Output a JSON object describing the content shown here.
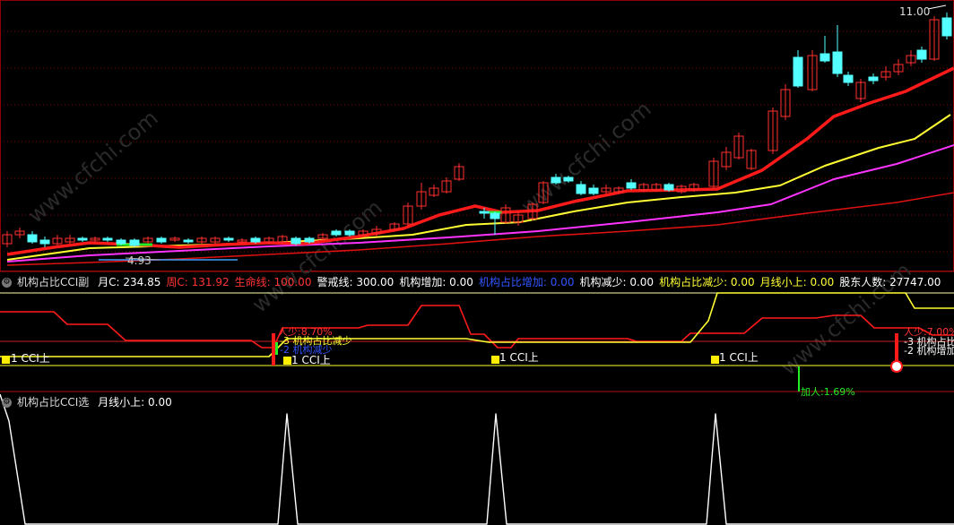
{
  "colors": {
    "background": "#000000",
    "grid": "#8b0000",
    "up_candle": "#ff3030",
    "down_candle": "#54ffff",
    "ma_red": "#ff1a1a",
    "ma_yellow": "#ffff33",
    "ma_magenta": "#ff33ff",
    "ma_dark": "#dd1111",
    "white": "#ffffff",
    "green": "#22ee22",
    "blue": "#3355ff"
  },
  "main_panel": {
    "high_label": "11.00",
    "low_label": "4.93",
    "watermark": "www.cfchi.com"
  },
  "indicator1": {
    "title": "机构占比CCI副",
    "items": [
      {
        "label": "月C: 234.85",
        "color": "#ffffff"
      },
      {
        "label": "周C: 131.92",
        "color": "#ff3333"
      },
      {
        "label": "生命线: 100.00",
        "color": "#ff3333"
      },
      {
        "label": "警戒线: 300.00",
        "color": "#ffffff"
      },
      {
        "label": "机构增加: 0.00",
        "color": "#ffffff"
      },
      {
        "label": "机构占比增加: 0.00",
        "color": "#3355ff"
      },
      {
        "label": "机构减少: 0.00",
        "color": "#ffffff"
      },
      {
        "label": "机构占比减少: 0.00",
        "color": "#ffff33"
      },
      {
        "label": "月线小上: 0.00",
        "color": "#ffff33"
      },
      {
        "label": "股东人数: 27747.00",
        "color": "#ffffff"
      }
    ],
    "cci_labels": [
      "1 CCI上",
      "1 CCI上",
      "1 CCI上",
      "1 CCI上"
    ],
    "left_annotations": [
      "人少:8.70%",
      "-3 机构占比减少",
      "-2 机构减少"
    ],
    "right_annotations": [
      "人少:7.00%",
      "-3 机构占比",
      "-2 机构增加"
    ],
    "bottom_annotation": "加人:1.69%"
  },
  "indicator2": {
    "title": "机构占比CCI选",
    "items": [
      {
        "label": "月线小上: 0.00",
        "color": "#ffffff"
      }
    ]
  }
}
